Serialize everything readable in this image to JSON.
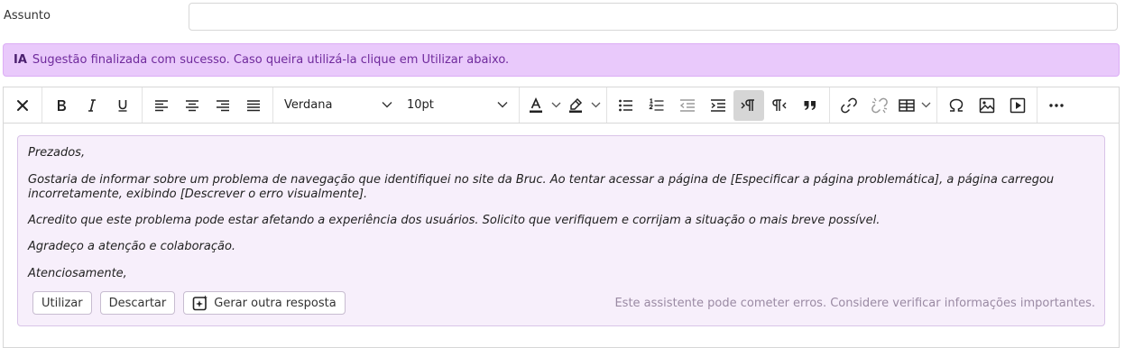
{
  "subject": {
    "label": "Assunto",
    "value": "",
    "placeholder": ""
  },
  "ia_banner": {
    "tag": "IA",
    "message": "Sugestão finalizada com sucesso. Caso queira utilizá-la clique em Utilizar abaixo."
  },
  "toolbar": {
    "font_family": "Verdana",
    "font_size": "10pt",
    "icons": [
      "close-icon",
      "bold-icon",
      "italic-icon",
      "underline-icon",
      "align-left-icon",
      "align-center-icon",
      "align-right-icon",
      "align-justify-icon",
      "text-color-icon",
      "highlight-icon",
      "bullet-list-icon",
      "numbered-list-icon",
      "outdent-icon",
      "indent-icon",
      "ltr-icon",
      "rtl-icon",
      "blockquote-icon",
      "link-icon",
      "unlink-icon",
      "table-icon",
      "special-char-icon",
      "image-icon",
      "media-icon",
      "more-icon"
    ],
    "text_color": "#222222",
    "highlight_color": "#222222",
    "active_button": "ltr"
  },
  "suggestion": {
    "paragraphs": [
      "Prezados,",
      "Gostaria de informar sobre um problema de navegação que identifiquei no site da Bruc. Ao tentar acessar a página de [Especificar a página problemática], a página carregou incorretamente, exibindo [Descrever o erro visualmente].",
      "Acredito que este problema pode estar afetando a experiência dos usuários. Solicito que verifiquem e corrijam a situação o mais breve possível.",
      "Agradeço a atenção e colaboração.",
      "Atenciosamente,"
    ],
    "buttons": {
      "use": "Utilizar",
      "discard": "Descartar",
      "regenerate": "Gerar outra resposta"
    },
    "disclaimer": "Este assistente pode cometer erros. Considere verificar informações importantes."
  },
  "colors": {
    "banner_bg": "#e9c9fb",
    "banner_text": "#6f2a9c",
    "suggestion_bg": "#f7effb",
    "disclaimer": "#9a8aa3"
  }
}
